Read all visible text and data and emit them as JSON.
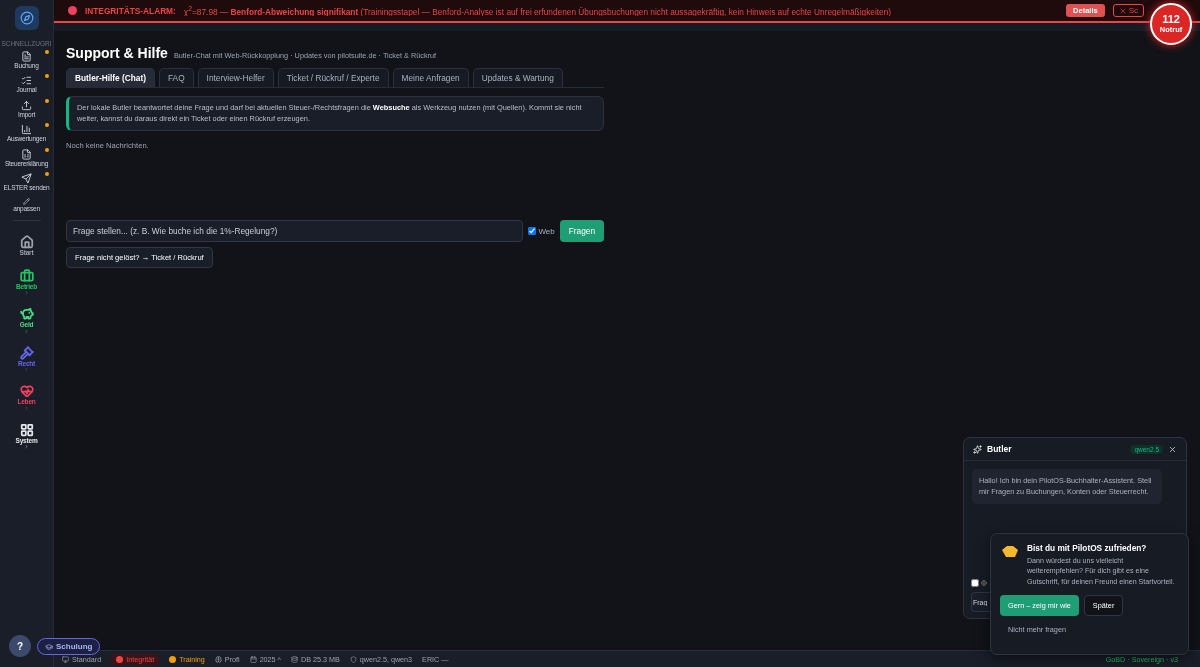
{
  "alarm": {
    "title": "INTEGRITÄTS-ALARM:",
    "message": "χ$^{2}$=87.98 — **Benford-Abweichung signifikant** (Trainingsstapel — Benford-Analyse ist auf frei erfundenen Übungsbuchungen nicht aussagekräftig, kein Hinweis auf echte Unregelmäßigkeiten)",
    "details_button": "Details",
    "close_button": "Sc"
  },
  "emergency": {
    "number": "112",
    "label": "Notruf"
  },
  "sidebar": {
    "section_label": "SCHNELLZUGRI",
    "quick": [
      {
        "label": "Buchung",
        "pinned": true
      },
      {
        "label": "Journal",
        "pinned": true
      },
      {
        "label": "Import",
        "pinned": true
      },
      {
        "label": "Auswertungen",
        "pinned": true
      },
      {
        "label": "Steuererklärung",
        "pinned": true
      },
      {
        "label": "ELSTER senden",
        "pinned": true
      },
      {
        "label": "anpassen",
        "pinned": false
      }
    ],
    "areas": [
      {
        "label": "Start",
        "color": "#9ca3af",
        "expandable": false
      },
      {
        "label": "Betrieb",
        "color": "#22c55e",
        "expandable": true
      },
      {
        "label": "Geld",
        "color": "#4ade80",
        "expandable": true
      },
      {
        "label": "Recht",
        "color": "#6366f1",
        "expandable": true
      },
      {
        "label": "Leben",
        "color": "#f43f5e",
        "expandable": true
      },
      {
        "label": "System",
        "color": "#e5e7eb",
        "expandable": true
      }
    ]
  },
  "page": {
    "title": "Support & Hilfe",
    "subtitle": "Butler-Chat mit Web-Rückkopplung · Updates von pilotsuite.de · Ticket & Rückruf",
    "tabs": [
      {
        "label": "Butler-Hilfe (Chat)",
        "selected": true
      },
      {
        "label": "FAQ",
        "selected": false
      },
      {
        "label": "Interview-Helfer",
        "selected": false
      },
      {
        "label": "Ticket / Rückruf / Experte",
        "selected": false
      },
      {
        "label": "Meine Anfragen",
        "selected": false
      },
      {
        "label": "Updates & Wartung",
        "selected": false
      }
    ],
    "info": "Der lokale Butler beantwortet deine Frage und darf bei aktuellen Steuer-/Rechtsfragen die **Websuche** als Werkzeug nutzen (mit Quellen). Kommt sie nicht weiter, kannst du daraus direkt ein Ticket oder einen Rückruf erzeugen.",
    "empty_note": "Noch keine Nachrichten.",
    "question": {
      "placeholder": "Frage stellen... (z. B. Wie buche ich die 1%-Regelung?)",
      "web_label": "Web",
      "web_checked": true,
      "submit": "Fragen"
    },
    "escalate_button": "Frage nicht gelöst? → Ticket / Rückruf"
  },
  "help_button": "?",
  "training_badge": "Schulung",
  "status_bar": {
    "items": [
      {
        "label": "Standard"
      },
      {
        "label": "Integrität",
        "color": "#ef4444"
      },
      {
        "label": "Training",
        "color": "#f59e0b"
      },
      {
        "label": "Profi"
      },
      {
        "label": "2025 ^"
      },
      {
        "label": "DB 25.3 MB"
      },
      {
        "label": "qwen2.5, qwen3"
      },
      {
        "label": "ERIC —"
      }
    ],
    "right": "GoBD · Sovereign · v3"
  },
  "butler": {
    "title": "Butler",
    "model": "qwen2.5",
    "greeting": "Hallo! Ich bin dein PilotOS-Buchhalter-Assistent. Stell mir Fragen zu Buchungen, Konten oder Steuerrecht.",
    "web_checked": false,
    "input_visible": "Frag"
  },
  "survey": {
    "title": "Bist du mit PilotOS zufrieden?",
    "text": "Dann würdest du uns vielleicht weiterempfehlen? Für dich gibt es eine Gutschrift, für deinen Freund einen Startvorteil.",
    "primary": "Gern – zeig mir wie",
    "secondary": "Später",
    "dismiss": "Nicht mehr fragen"
  }
}
